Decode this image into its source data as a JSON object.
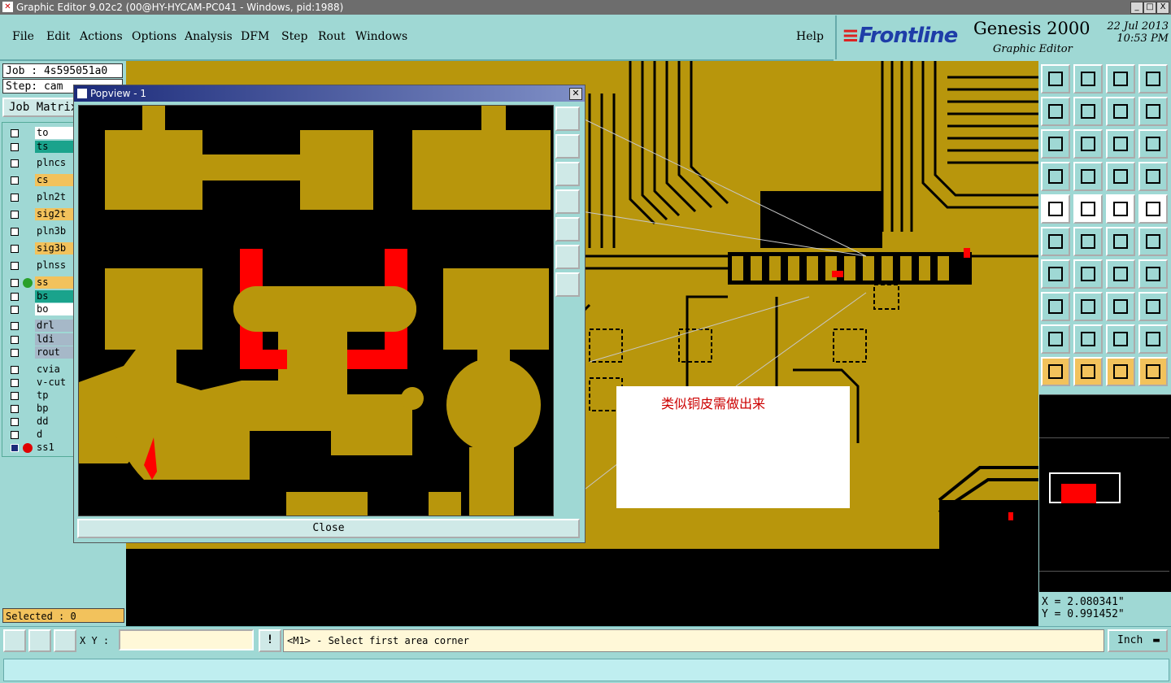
{
  "window": {
    "title": "Graphic Editor 9.02c2 (00@HY-HYCAM-PC041 - Windows, pid:1988)",
    "controls": [
      "_",
      "□",
      "X"
    ]
  },
  "menu": {
    "items": [
      "File",
      "Edit",
      "Actions",
      "Options",
      "Analysis",
      "DFM",
      "Step",
      "Rout",
      "Windows"
    ],
    "help": "Help"
  },
  "brand": {
    "logo": "Frontline",
    "product": "Genesis 2000",
    "subtitle": "Graphic Editor",
    "date": "22 Jul 2013",
    "time": "10:53 PM"
  },
  "job": {
    "job_line": "Job : 4s595051a0",
    "step_line": "Step: cam",
    "matrix_button": "Job Matrix"
  },
  "layers": [
    {
      "name": "to",
      "color": "#ffffff",
      "dot": ""
    },
    {
      "name": "ts",
      "color": "#1aa38c",
      "dot": ""
    },
    {
      "name": "plncs",
      "color": "#9fd8d4",
      "dot": ""
    },
    {
      "name": "cs",
      "color": "#f2c25c",
      "dot": ""
    },
    {
      "name": "pln2t",
      "color": "#9fd8d4",
      "dot": ""
    },
    {
      "name": "sig2t",
      "color": "#f2c25c",
      "dot": ""
    },
    {
      "name": "pln3b",
      "color": "#9fd8d4",
      "dot": ""
    },
    {
      "name": "sig3b",
      "color": "#f2c25c",
      "dot": ""
    },
    {
      "name": "plnss",
      "color": "#9fd8d4",
      "dot": ""
    },
    {
      "name": "ss",
      "color": "#f2c25c",
      "dot": "#2aa02a"
    },
    {
      "name": "bs",
      "color": "#1aa38c",
      "dot": ""
    },
    {
      "name": "bo",
      "color": "#ffffff",
      "dot": ""
    },
    {
      "name": "drl",
      "color": "#a6b8c8",
      "dot": ""
    },
    {
      "name": "ldi",
      "color": "#a6b8c8",
      "dot": ""
    },
    {
      "name": "rout",
      "color": "#a6b8c8",
      "dot": ""
    },
    {
      "name": "cvia",
      "color": "#9fd8d4",
      "dot": ""
    },
    {
      "name": "v-cut",
      "color": "#9fd8d4",
      "dot": ""
    },
    {
      "name": "tp",
      "color": "#9fd8d4",
      "dot": ""
    },
    {
      "name": "bp",
      "color": "#9fd8d4",
      "dot": ""
    },
    {
      "name": "dd",
      "color": "#9fd8d4",
      "dot": ""
    },
    {
      "name": "d",
      "color": "#9fd8d4",
      "dot": ""
    },
    {
      "name": "ss1",
      "color": "#9fd8d4",
      "dot": "#e00000"
    }
  ],
  "selected": "Selected : 0",
  "popview": {
    "title": "Popview - 1",
    "close_label": "Close"
  },
  "annotation": "类似铜皮需做出来",
  "coords": {
    "x": "X = 2.080341\"",
    "y": "Y = 0.991452\""
  },
  "bottom": {
    "xy_label": "X Y :",
    "xy_value": "",
    "message": "<M1> - Select first area corner",
    "unit": "Inch"
  },
  "colors": {
    "copper": "#b8960c",
    "board": "#000000",
    "highlight": "#ff0000",
    "panel": "#9fd8d4"
  }
}
